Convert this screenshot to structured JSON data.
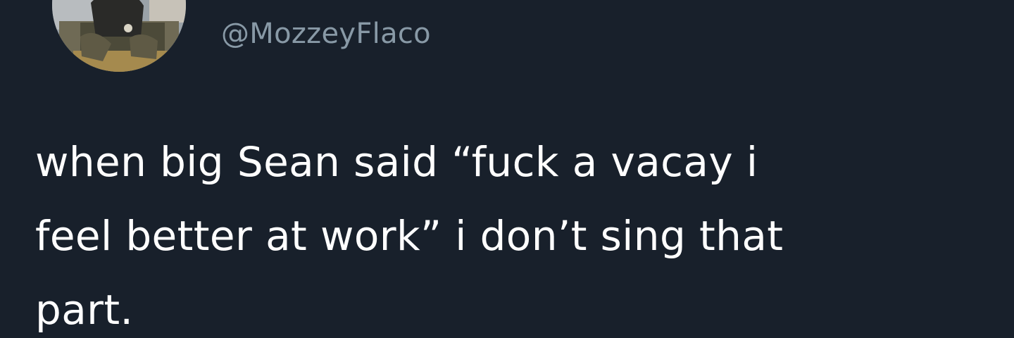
{
  "tweet": {
    "handle": "@MozzeyFlaco",
    "text": "when big Sean said “fuck a vacay i\nfeel better at work” i don’t sing that\npart."
  },
  "colors": {
    "background": "#18202b",
    "handle": "#8899a6",
    "text": "#ffffff"
  }
}
